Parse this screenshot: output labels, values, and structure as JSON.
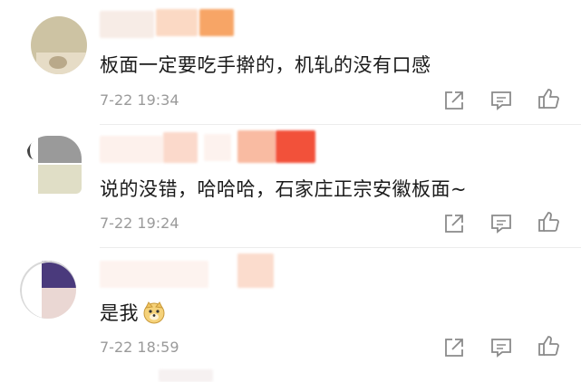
{
  "comments": [
    {
      "text": "板面一定要吃手擀的，机轧的没有口感",
      "time": "7-22 19:34",
      "avatar_colors": [
        "#c9bfa1",
        "#e8e2d0",
        "#bfb6a0"
      ],
      "name_blur_colors": [
        "#f6e3d8",
        "#fbd3b8",
        "#f7a566"
      ]
    },
    {
      "text": "说的没错，哈哈哈，石家庄正宗安徽板面~",
      "time": "7-22 19:24",
      "avatar_colors": [
        "#9b9b9b",
        "#e2e0c8",
        "#ffffff"
      ],
      "name_blur_colors": [
        "#fbe5dc",
        "#f9c8b2",
        "#f2603f"
      ]
    },
    {
      "text": "是我",
      "emoji": "dog-face",
      "time": "7-22 18:59",
      "avatar_colors": [
        "#4c3a7a",
        "#e8d6d2",
        "#ffffff"
      ],
      "name_blur_colors": [
        "#fbe8e0",
        "#fbd5c4"
      ]
    }
  ],
  "actions": [
    "share-icon",
    "comment-icon",
    "like-icon"
  ]
}
